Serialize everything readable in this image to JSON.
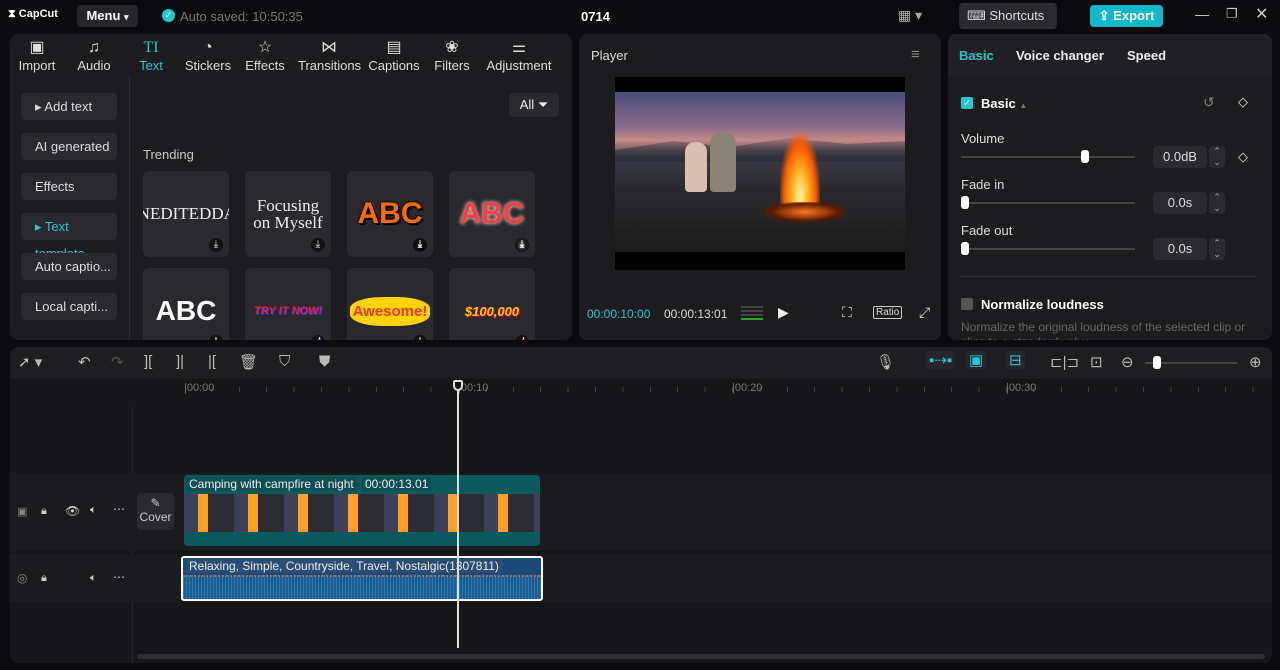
{
  "app": {
    "logo": "CapCut",
    "menu": "Menu",
    "autosave": "Auto saved: 10:50:35",
    "project": "0714",
    "shortcuts": "Shortcuts",
    "export": "Export"
  },
  "toolbar_tabs": [
    {
      "label": "Import",
      "icon": "import-icon"
    },
    {
      "label": "Audio",
      "icon": "audio-icon"
    },
    {
      "label": "Text",
      "icon": "text-icon",
      "active": true
    },
    {
      "label": "Stickers",
      "icon": "stickers-icon"
    },
    {
      "label": "Effects",
      "icon": "effects-icon"
    },
    {
      "label": "Transitions",
      "icon": "transitions-icon"
    },
    {
      "label": "Captions",
      "icon": "captions-icon"
    },
    {
      "label": "Filters",
      "icon": "filters-icon"
    },
    {
      "label": "Adjustment",
      "icon": "adjustment-icon"
    }
  ],
  "text_sidebar": [
    "Add text",
    "AI generated",
    "Effects",
    "Text template",
    "Auto captio...",
    "Local capti..."
  ],
  "filter": "All",
  "section": "Trending",
  "templates": [
    "UNEDITEDDAY",
    "Focusing on Myself",
    "ABC",
    "ABC",
    "ABC",
    "TRY IT NOW!",
    "Awesome!",
    "$100,000"
  ],
  "player": {
    "title": "Player",
    "current": "00:00:10:00",
    "total": "00:00:13:01",
    "ratio": "Ratio"
  },
  "right": {
    "tabs": [
      "Basic",
      "Voice changer",
      "Speed"
    ],
    "section": "Basic",
    "volume_label": "Volume",
    "volume": "0.0dB",
    "volume_level": 0.72,
    "fadein_label": "Fade in",
    "fadein": "0.0s",
    "fadeout_label": "Fade out",
    "fadeout": "0.0s",
    "normalize": "Normalize loudness",
    "normalize_desc": "Normalize the original loudness of the selected clip or clips to a standard value."
  },
  "timeline": {
    "ticks": [
      "00:00",
      "00:10",
      "00:20",
      "00:30"
    ],
    "cover": "Cover",
    "video_clip": "Camping with campfire at night",
    "video_dur": "00:00:13.01",
    "audio_clip": "Relaxing, Simple, Countryside, Travel, Nostalgic(1307811)"
  },
  "colors": {
    "accent": "#1fc8d6",
    "export": "#11b9c8",
    "video": "#0d5a5e",
    "audio": "#1b4a7a"
  }
}
